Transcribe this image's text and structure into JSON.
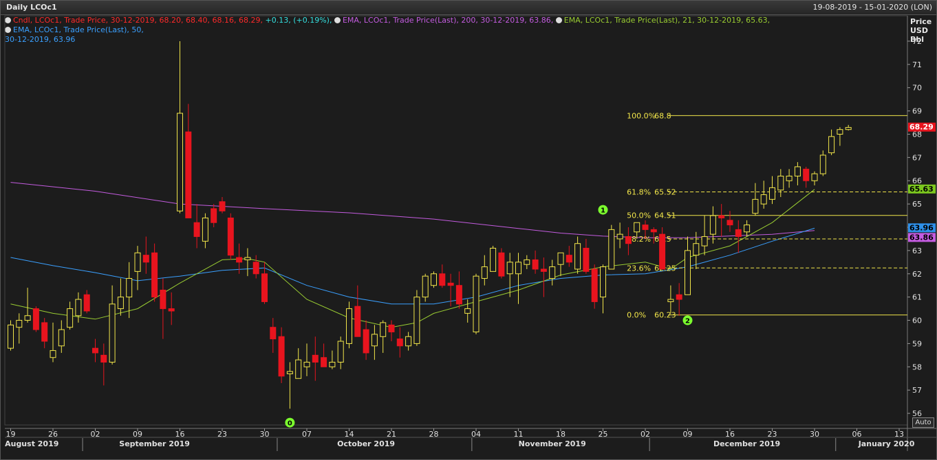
{
  "header": {
    "title": "Daily LCOc1",
    "date_range": "19-08-2019 - 15-01-2020 (LON)"
  },
  "legend": {
    "candle": {
      "text": "Cndl, LCOc1, Trade Price, 30-12-2019, 68.20, 68.40, 68.16, 68.29,",
      "change": "+0.13, (+0.19%),",
      "color": "#ff2a2a",
      "change_color": "#34e0e0"
    },
    "ema200": {
      "text": "EMA, LCOc1, Trade Price(Last), 200, 30-12-2019, 63.86,",
      "color": "#c45ce0"
    },
    "ema21": {
      "text": "EMA, LCOc1, Trade Price(Last), 21, 30-12-2019, 65.63,",
      "color": "#9acd32"
    },
    "ema50": {
      "text": "EMA, LCOc1, Trade Price(Last), 50,",
      "line2": "30-12-2019, 63.96",
      "color": "#3aa0ff"
    }
  },
  "y_axis_header": [
    "Price",
    "USD",
    "Bbl"
  ],
  "auto_label": "Auto",
  "chart_data": {
    "type": "candlestick",
    "ylim": [
      55.5,
      72.5
    ],
    "y_ticks": [
      56,
      57,
      58,
      59,
      60,
      61,
      62,
      63,
      64,
      65,
      66,
      67,
      68,
      69,
      70,
      71,
      72
    ],
    "x_tick_labels": [
      {
        "label": "19",
        "i": 0
      },
      {
        "label": "26",
        "i": 5
      },
      {
        "label": "02",
        "i": 10
      },
      {
        "label": "09",
        "i": 15
      },
      {
        "label": "16",
        "i": 20
      },
      {
        "label": "23",
        "i": 25
      },
      {
        "label": "30",
        "i": 30
      },
      {
        "label": "07",
        "i": 35
      },
      {
        "label": "14",
        "i": 40
      },
      {
        "label": "21",
        "i": 45
      },
      {
        "label": "28",
        "i": 50
      },
      {
        "label": "04",
        "i": 55
      },
      {
        "label": "11",
        "i": 60
      },
      {
        "label": "18",
        "i": 65
      },
      {
        "label": "25",
        "i": 70
      },
      {
        "label": "02",
        "i": 75
      },
      {
        "label": "09",
        "i": 80
      },
      {
        "label": "16",
        "i": 85
      },
      {
        "label": "23",
        "i": 90
      },
      {
        "label": "30",
        "i": 95
      },
      {
        "label": "06",
        "i": 100
      },
      {
        "label": "13",
        "i": 105
      }
    ],
    "month_labels": [
      {
        "label": "August 2019",
        "i": 2.5
      },
      {
        "label": "September 2019",
        "i": 17
      },
      {
        "label": "October 2019",
        "i": 42
      },
      {
        "label": "November 2019",
        "i": 64
      },
      {
        "label": "December 2019",
        "i": 87
      },
      {
        "label": "January 2020",
        "i": 103.5
      }
    ],
    "month_separators": [
      8.5,
      31.5,
      54.5,
      75.5,
      97.5
    ],
    "candles": [
      [
        58.8,
        60.0,
        58.7,
        59.8
      ],
      [
        59.7,
        60.3,
        59.0,
        60.0
      ],
      [
        60.0,
        61.4,
        59.9,
        60.2
      ],
      [
        60.5,
        60.6,
        59.5,
        59.6
      ],
      [
        59.9,
        60.1,
        58.8,
        59.1
      ],
      [
        58.4,
        59.9,
        58.2,
        58.7
      ],
      [
        58.9,
        60.0,
        58.6,
        59.6
      ],
      [
        59.7,
        60.8,
        59.6,
        60.5
      ],
      [
        60.2,
        61.2,
        59.9,
        60.9
      ],
      [
        61.1,
        61.3,
        60.3,
        60.4
      ],
      [
        58.8,
        59.2,
        58.2,
        58.6
      ],
      [
        58.5,
        59.0,
        57.2,
        58.2
      ],
      [
        58.2,
        61.5,
        58.1,
        60.7
      ],
      [
        60.5,
        61.8,
        60.2,
        61.0
      ],
      [
        61.0,
        62.5,
        60.1,
        61.8
      ],
      [
        62.1,
        63.2,
        61.3,
        62.9
      ],
      [
        62.8,
        63.6,
        62.0,
        62.5
      ],
      [
        62.9,
        63.3,
        60.8,
        61.0
      ],
      [
        61.3,
        61.8,
        59.2,
        60.5
      ],
      [
        60.5,
        61.2,
        59.8,
        60.4
      ],
      [
        64.7,
        72.0,
        64.6,
        68.9
      ],
      [
        68.1,
        69.3,
        64.7,
        64.4
      ],
      [
        64.2,
        65.0,
        63.1,
        63.6
      ],
      [
        63.4,
        64.6,
        63.1,
        64.4
      ],
      [
        64.8,
        65.0,
        64.0,
        64.2
      ],
      [
        65.1,
        65.3,
        64.6,
        64.7
      ],
      [
        64.4,
        64.6,
        62.6,
        62.8
      ],
      [
        62.7,
        63.3,
        62.0,
        62.5
      ],
      [
        62.6,
        63.1,
        61.9,
        62.7
      ],
      [
        62.5,
        62.8,
        61.8,
        62.0
      ],
      [
        62.0,
        62.5,
        60.7,
        60.8
      ],
      [
        59.7,
        60.1,
        58.6,
        59.2
      ],
      [
        59.3,
        59.7,
        57.3,
        57.6
      ],
      [
        57.7,
        58.2,
        56.2,
        57.8
      ],
      [
        57.5,
        58.8,
        57.8,
        58.3
      ],
      [
        58.0,
        59.0,
        57.6,
        58.2
      ],
      [
        58.5,
        59.3,
        57.4,
        58.2
      ],
      [
        58.4,
        59.0,
        58.2,
        58.0
      ],
      [
        58.0,
        58.7,
        57.9,
        58.2
      ],
      [
        58.2,
        59.3,
        57.9,
        59.1
      ],
      [
        59.0,
        60.8,
        58.8,
        60.5
      ],
      [
        60.6,
        61.5,
        59.9,
        59.3
      ],
      [
        59.6,
        60.0,
        58.3,
        58.6
      ],
      [
        58.9,
        59.8,
        58.3,
        59.4
      ],
      [
        59.3,
        60.0,
        58.6,
        59.9
      ],
      [
        59.8,
        60.0,
        59.1,
        59.5
      ],
      [
        59.2,
        59.7,
        58.4,
        58.9
      ],
      [
        58.9,
        59.5,
        58.7,
        59.3
      ],
      [
        59.0,
        61.3,
        58.9,
        61.0
      ],
      [
        61.0,
        62.0,
        60.8,
        61.9
      ],
      [
        61.5,
        62.1,
        61.4,
        62.0
      ],
      [
        62.0,
        62.4,
        61.4,
        61.5
      ],
      [
        61.6,
        62.0,
        60.6,
        61.5
      ],
      [
        61.5,
        62.1,
        60.5,
        60.7
      ],
      [
        60.3,
        60.9,
        59.9,
        60.5
      ],
      [
        59.5,
        62.0,
        59.4,
        61.9
      ],
      [
        61.8,
        62.8,
        61.5,
        62.3
      ],
      [
        62.1,
        63.2,
        62.1,
        63.1
      ],
      [
        62.9,
        63.1,
        61.8,
        61.9
      ],
      [
        62.0,
        62.9,
        61.0,
        62.5
      ],
      [
        62.0,
        62.9,
        60.7,
        62.5
      ],
      [
        62.4,
        62.8,
        62.2,
        62.6
      ],
      [
        62.6,
        63.0,
        62.0,
        62.2
      ],
      [
        62.2,
        62.7,
        61.0,
        62.1
      ],
      [
        61.8,
        62.6,
        61.5,
        62.3
      ],
      [
        62.4,
        62.9,
        61.9,
        62.9
      ],
      [
        62.8,
        63.2,
        62.3,
        62.5
      ],
      [
        62.2,
        63.6,
        62.0,
        63.3
      ],
      [
        63.1,
        63.5,
        62.0,
        62.1
      ],
      [
        62.2,
        62.4,
        60.5,
        60.8
      ],
      [
        61.0,
        62.4,
        60.3,
        62.3
      ],
      [
        62.2,
        64.1,
        62.2,
        63.9
      ],
      [
        63.5,
        64.2,
        63.1,
        63.7
      ],
      [
        63.6,
        64.0,
        62.8,
        63.3
      ],
      [
        63.8,
        64.2,
        63.5,
        64.2
      ],
      [
        64.1,
        64.3,
        63.5,
        63.9
      ],
      [
        63.9,
        64.0,
        63.3,
        63.8
      ],
      [
        63.7,
        64.0,
        62.8,
        62.2
      ],
      [
        60.8,
        61.5,
        60.3,
        60.9
      ],
      [
        61.1,
        61.6,
        60.2,
        60.9
      ],
      [
        61.1,
        63.6,
        61.1,
        63.0
      ],
      [
        62.8,
        63.8,
        62.2,
        63.3
      ],
      [
        63.2,
        64.5,
        62.8,
        63.6
      ],
      [
        63.7,
        64.9,
        63.3,
        64.5
      ],
      [
        64.5,
        65.0,
        63.6,
        64.4
      ],
      [
        64.3,
        64.7,
        63.8,
        64.1
      ],
      [
        63.9,
        64.3,
        62.9,
        63.6
      ],
      [
        63.8,
        64.3,
        63.6,
        64.1
      ],
      [
        64.6,
        65.9,
        64.5,
        65.2
      ],
      [
        65.0,
        66.0,
        64.8,
        65.4
      ],
      [
        65.2,
        66.2,
        65.0,
        65.7
      ],
      [
        65.6,
        66.5,
        65.3,
        66.2
      ],
      [
        66.0,
        66.5,
        65.7,
        66.2
      ],
      [
        66.2,
        66.8,
        65.8,
        66.6
      ],
      [
        66.5,
        66.6,
        65.7,
        66.0
      ],
      [
        66.0,
        66.4,
        65.8,
        66.3
      ],
      [
        66.3,
        67.3,
        66.2,
        67.1
      ],
      [
        67.2,
        68.2,
        67.1,
        67.9
      ],
      [
        68.0,
        68.3,
        67.5,
        68.2
      ],
      [
        68.2,
        68.4,
        68.16,
        68.29
      ]
    ],
    "ema200": [
      [
        0,
        65.93
      ],
      [
        10,
        65.55
      ],
      [
        20,
        65.0
      ],
      [
        30,
        64.8
      ],
      [
        40,
        64.62
      ],
      [
        50,
        64.35
      ],
      [
        60,
        63.95
      ],
      [
        65,
        63.75
      ],
      [
        70,
        63.62
      ],
      [
        75,
        63.55
      ],
      [
        80,
        63.55
      ],
      [
        90,
        63.7
      ],
      [
        95,
        63.86
      ]
    ],
    "ema50": [
      [
        0,
        62.7
      ],
      [
        5,
        62.35
      ],
      [
        10,
        62.05
      ],
      [
        15,
        61.7
      ],
      [
        20,
        61.9
      ],
      [
        25,
        62.15
      ],
      [
        30,
        62.25
      ],
      [
        35,
        61.5
      ],
      [
        40,
        61.0
      ],
      [
        45,
        60.7
      ],
      [
        50,
        60.7
      ],
      [
        55,
        61.0
      ],
      [
        60,
        61.5
      ],
      [
        65,
        61.8
      ],
      [
        70,
        61.95
      ],
      [
        75,
        62.0
      ],
      [
        80,
        62.3
      ],
      [
        85,
        62.8
      ],
      [
        90,
        63.4
      ],
      [
        95,
        63.96
      ]
    ],
    "ema21": [
      [
        0,
        60.7
      ],
      [
        5,
        60.3
      ],
      [
        10,
        60.05
      ],
      [
        15,
        60.5
      ],
      [
        20,
        61.6
      ],
      [
        25,
        62.6
      ],
      [
        28,
        62.65
      ],
      [
        30,
        62.5
      ],
      [
        35,
        60.9
      ],
      [
        40,
        60.1
      ],
      [
        45,
        59.7
      ],
      [
        48,
        59.9
      ],
      [
        50,
        60.3
      ],
      [
        55,
        60.8
      ],
      [
        60,
        61.3
      ],
      [
        65,
        61.95
      ],
      [
        70,
        62.3
      ],
      [
        75,
        62.5
      ],
      [
        78,
        62.2
      ],
      [
        80,
        62.7
      ],
      [
        85,
        63.2
      ],
      [
        90,
        64.2
      ],
      [
        95,
        65.63
      ]
    ],
    "fibonacci": {
      "start_index": 72,
      "levels": [
        {
          "label": "100.0%",
          "value": 68.8,
          "style": "solid"
        },
        {
          "label": "61.8%",
          "value": 65.52,
          "style": "dashed"
        },
        {
          "label": "50.0%",
          "value": 64.51,
          "style": "solid"
        },
        {
          "label": "38.2%",
          "value": 63.5,
          "style": "dashed"
        },
        {
          "label": "23.6%",
          "value": 62.25,
          "style": "dashed"
        },
        {
          "label": "0.0%",
          "value": 60.23,
          "style": "solid"
        }
      ]
    },
    "markers": [
      {
        "label": "0",
        "i": 33,
        "value": 55.6
      },
      {
        "label": "1",
        "i": 70,
        "value": 64.75
      },
      {
        "label": "2",
        "i": 80,
        "value": 60.0
      }
    ],
    "price_tags": [
      {
        "value": 68.29,
        "label": "68.29",
        "color": "#e8141e",
        "text_color": "#ffffff"
      },
      {
        "value": 65.63,
        "label": "65.63",
        "color": "#7cc81e",
        "text_color": "#000000"
      },
      {
        "value": 63.96,
        "label": "63.96",
        "color": "#2e8fe8",
        "text_color": "#000000"
      },
      {
        "value": 63.86,
        "label": "63.86",
        "color": "#c45ce0",
        "text_color": "#000000"
      }
    ],
    "colors": {
      "up": "#f2e64a",
      "down": "#e8141e",
      "fib": "#f2e64a",
      "marker": "#7cff2e"
    }
  }
}
